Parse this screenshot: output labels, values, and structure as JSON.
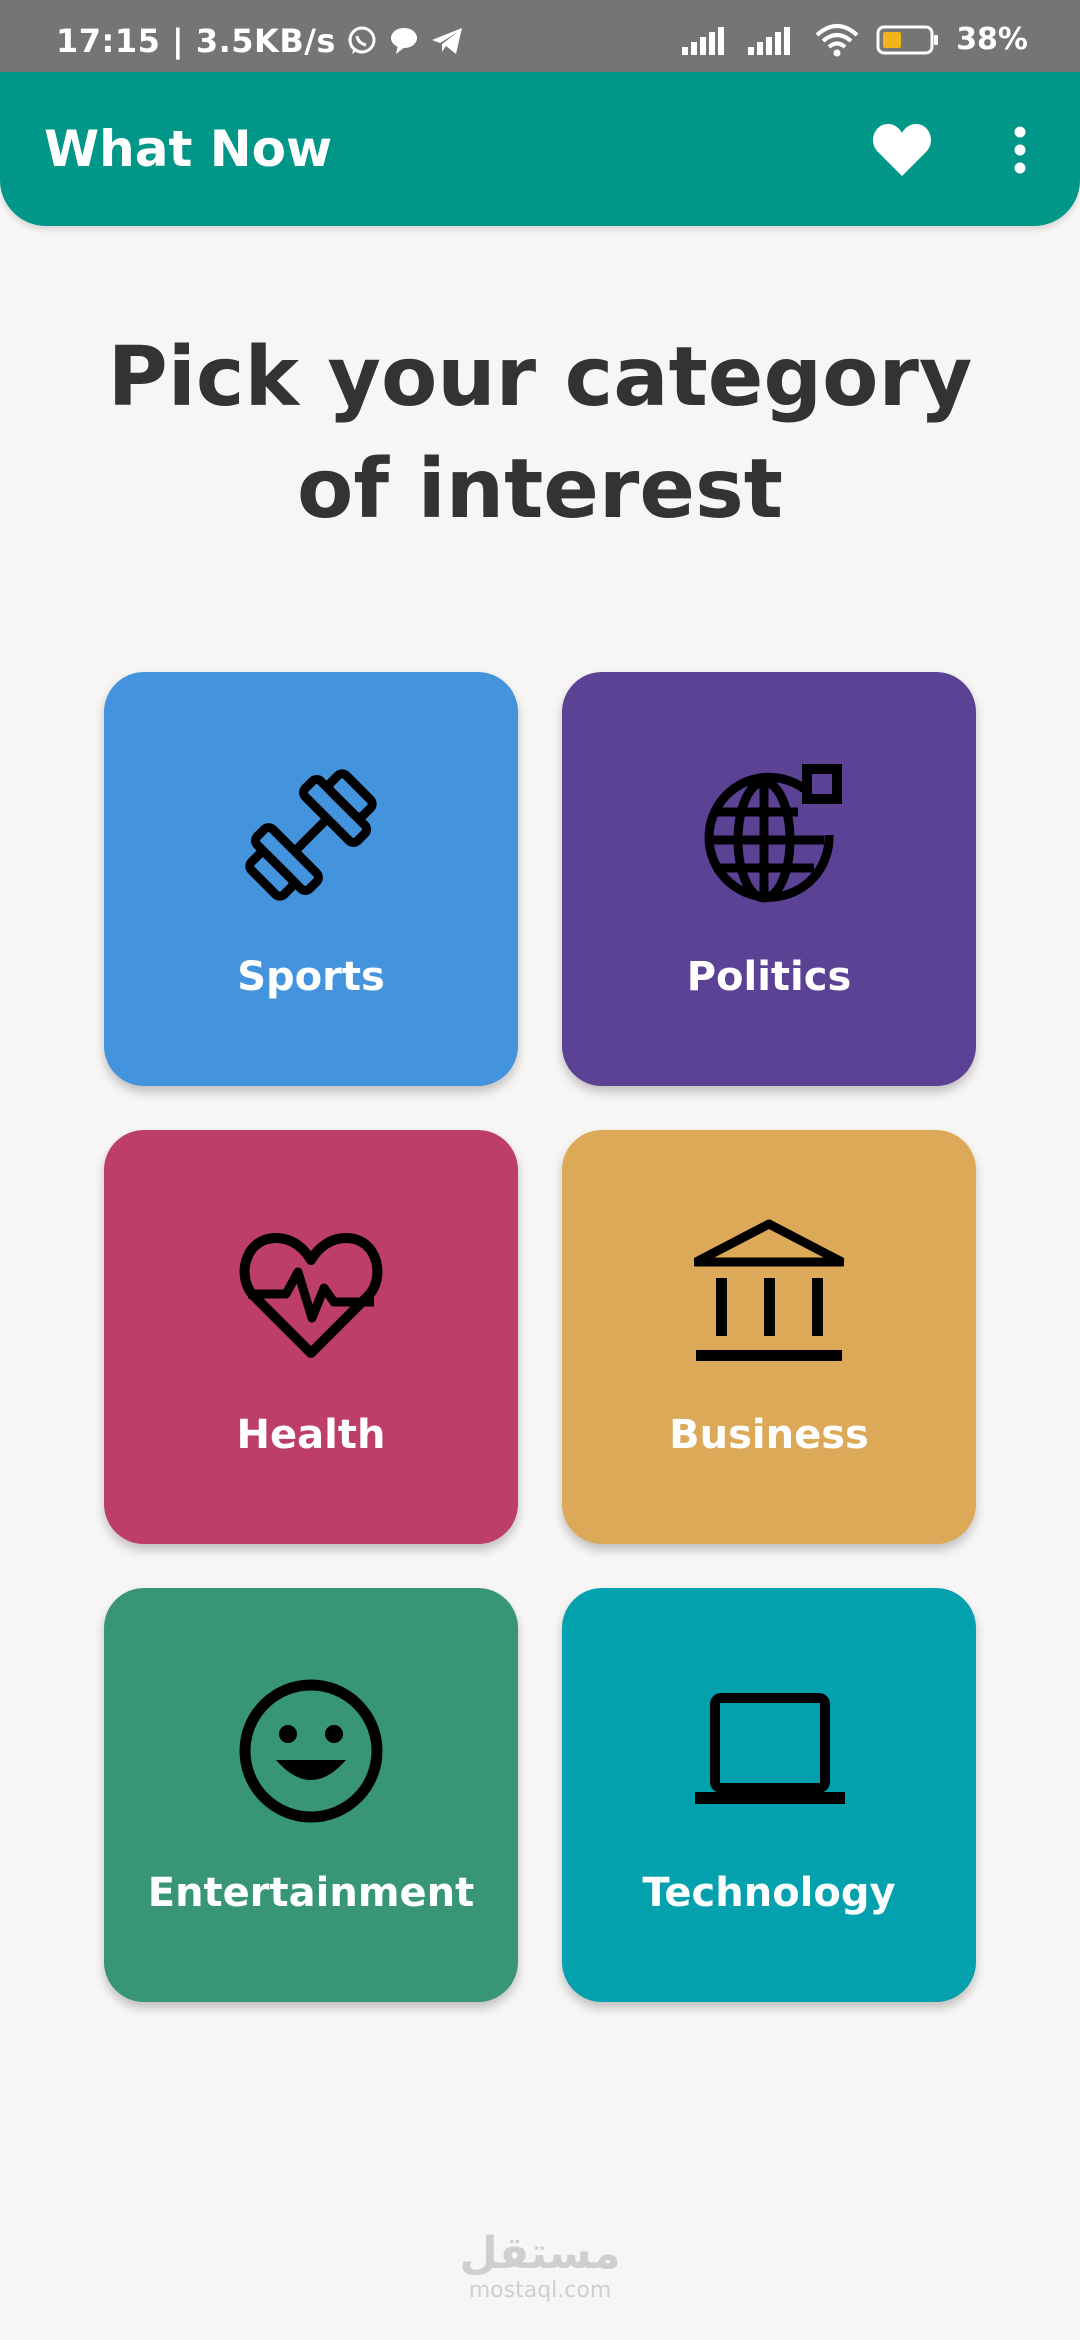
{
  "status_bar": {
    "time": "17:15 | 3.5KB/s",
    "battery": "38%"
  },
  "app_bar": {
    "title": "What Now"
  },
  "heading": "Pick your category of interest",
  "colors": {
    "app_bar": "#009688",
    "sports": "#4393dd",
    "politics": "#5b4294",
    "health": "#bc3e69",
    "business": "#dba958",
    "entertainment": "#389675",
    "technology": "#03a0ad"
  },
  "categories": [
    {
      "label": "Sports",
      "icon": "dumbbell-icon"
    },
    {
      "label": "Politics",
      "icon": "globe-icon"
    },
    {
      "label": "Health",
      "icon": "heart-pulse-icon"
    },
    {
      "label": "Business",
      "icon": "bank-icon"
    },
    {
      "label": "Entertainment",
      "icon": "smiley-icon"
    },
    {
      "label": "Technology",
      "icon": "laptop-icon"
    }
  ],
  "watermark": {
    "arabic": "مستقل",
    "latin": "mostaql.com"
  }
}
